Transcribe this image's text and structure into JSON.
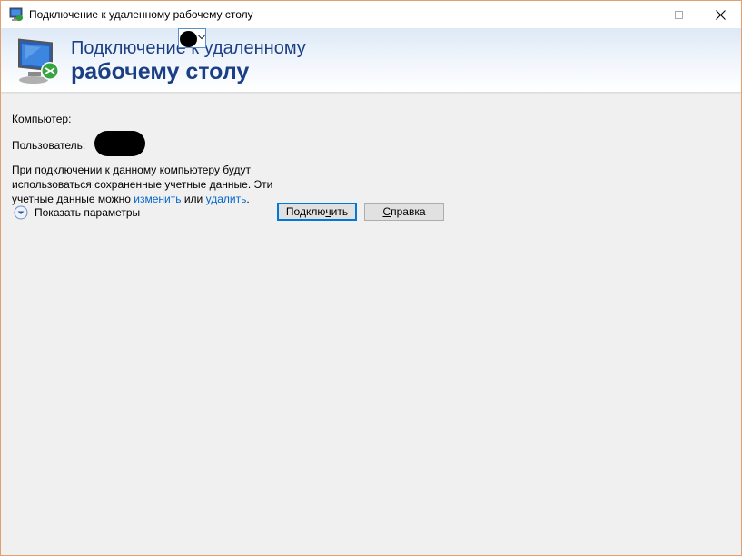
{
  "window": {
    "title": "Подключение к удаленному рабочему столу",
    "icon": "remote-desktop-icon",
    "controls": {
      "minimize": "minimize-icon",
      "maximize": "maximize-icon",
      "close": "close-icon"
    }
  },
  "banner": {
    "line1": "Подключение к удаленному",
    "line2": "рабочему столу",
    "icon": "remote-desktop-monitor-icon"
  },
  "form": {
    "computer_label": "Компьютер:",
    "user_label": "Пользователь:",
    "info_line1": "При подключении к данному компьютеру будут",
    "info_line2": "использоваться сохраненные учетные данные.  Эти",
    "info_line3_prefix": "учетные данные можно ",
    "link_edit": "изменить",
    "info_mid": " или ",
    "link_delete": "удалить",
    "info_end": "."
  },
  "options": {
    "label": "Показать параметры",
    "icon": "expand-options-icon"
  },
  "buttons": {
    "connect_pre": "Подклю",
    "connect_mn": "ч",
    "connect_post": "ить",
    "help_mn": "С",
    "help_post": "правка"
  },
  "colors": {
    "banner_text": "#1b3f85",
    "link": "#0066cc",
    "focus": "#0078d7",
    "window_border": "#e3a06e"
  }
}
